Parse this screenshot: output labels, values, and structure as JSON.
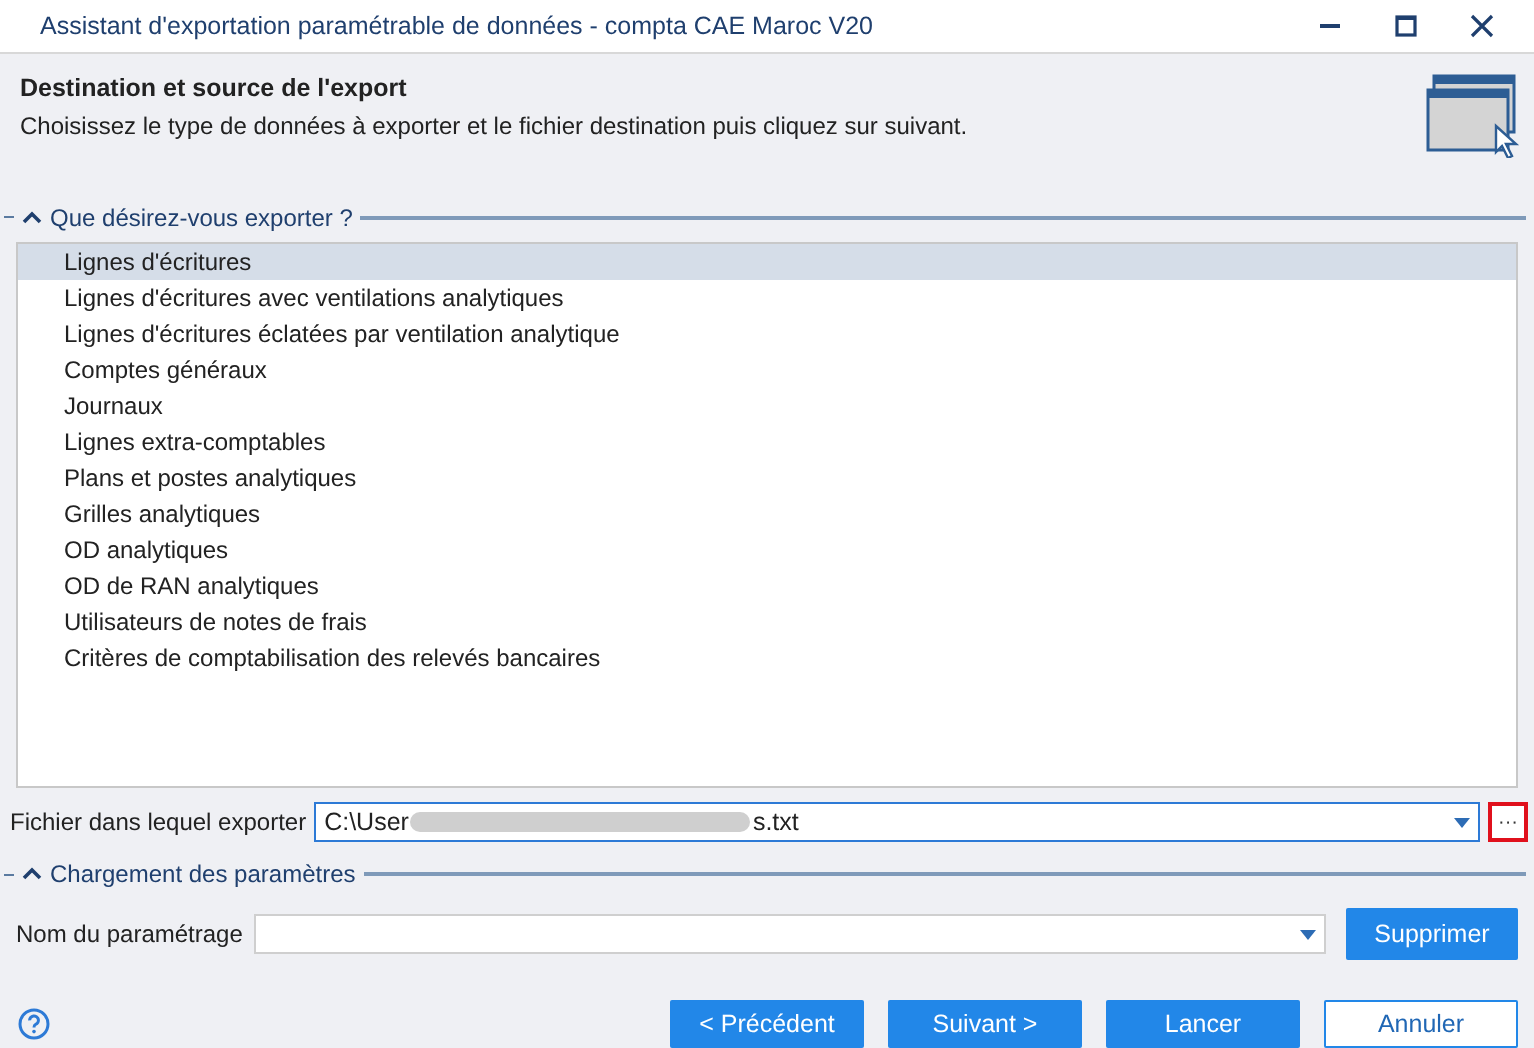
{
  "window": {
    "title": "Assistant d'exportation paramétrable de données - compta CAE Maroc V20"
  },
  "header": {
    "title": "Destination et source de l'export",
    "subtitle": "Choisissez le type de données à exporter et le fichier destination puis cliquez sur suivant."
  },
  "export_group": {
    "title": "Que désirez-vous exporter ?",
    "expanded": true,
    "items": [
      {
        "label": "Lignes d'écritures",
        "selected": true
      },
      {
        "label": "Lignes d'écritures avec ventilations analytiques",
        "selected": false
      },
      {
        "label": "Lignes d'écritures éclatées par ventilation analytique",
        "selected": false
      },
      {
        "label": "Comptes généraux",
        "selected": false
      },
      {
        "label": "Journaux",
        "selected": false
      },
      {
        "label": "Lignes extra-comptables",
        "selected": false
      },
      {
        "label": "Plans et postes analytiques",
        "selected": false
      },
      {
        "label": "Grilles analytiques",
        "selected": false
      },
      {
        "label": "OD analytiques",
        "selected": false
      },
      {
        "label": "OD de RAN analytiques",
        "selected": false
      },
      {
        "label": "Utilisateurs de notes de frais",
        "selected": false
      },
      {
        "label": "Critères de comptabilisation des relevés bancaires",
        "selected": false
      }
    ]
  },
  "file": {
    "label": "Fichier dans lequel exporter",
    "value_start": "C:\\User",
    "value_end": "s.txt",
    "browse": "···"
  },
  "settings_group": {
    "title": "Chargement des paramètres",
    "expanded": true,
    "label": "Nom du paramétrage",
    "delete_button": "Supprimer"
  },
  "buttons": [
    {
      "label": "< Précédent",
      "kind": "primary"
    },
    {
      "label": "Suivant >",
      "kind": "primary"
    },
    {
      "label": "Lancer",
      "kind": "primary"
    },
    {
      "label": "Annuler",
      "kind": "secondary"
    }
  ]
}
